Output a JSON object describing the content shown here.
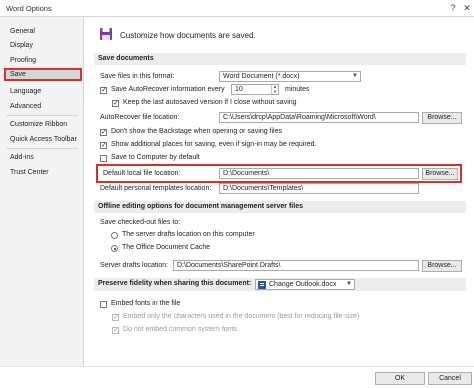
{
  "window": {
    "title": "Word Options",
    "help_icon": "?",
    "close_icon": "✕"
  },
  "nav": {
    "items": [
      {
        "label": "General"
      },
      {
        "label": "Display"
      },
      {
        "label": "Proofing"
      },
      {
        "label": "Save"
      },
      {
        "label": "Language"
      },
      {
        "label": "Advanced"
      },
      {
        "label": "Customize Ribbon"
      },
      {
        "label": "Quick Access Toolbar"
      },
      {
        "label": "Add-ins"
      },
      {
        "label": "Trust Center"
      }
    ],
    "selected": "Save"
  },
  "header": {
    "text": "Customize how documents are saved.",
    "icon": "save-icon"
  },
  "save_documents": {
    "title": "Save documents",
    "format_label": "Save files in this format:",
    "format_value": "Word Document (*.docx)",
    "autorecover_label": "Save AutoRecover information every",
    "autorecover_checked": true,
    "autorecover_minutes": "10",
    "minutes_label": "minutes",
    "keep_last_label": "Keep the last autosaved version if I close without saving",
    "keep_last_checked": true,
    "autorecover_location_label": "AutoRecover file location:",
    "autorecover_location_value": "C:\\Users\\drcp\\AppData\\Roaming\\Microsoft\\Word\\",
    "browse_label": "Browse...",
    "backstage_label": "Don't show the Backstage when opening or saving files",
    "backstage_checked": true,
    "additional_places_label": "Show additional places for saving, even if sign-in may be required.",
    "additional_places_checked": true,
    "save_computer_label": "Save to Computer by default",
    "save_computer_checked": false,
    "default_local_label": "Default local file location:",
    "default_local_value": "D:\\Documents\\",
    "default_templates_label": "Default personal templates location:",
    "default_templates_value": "D:\\Documents\\Templates\\"
  },
  "offline": {
    "title": "Offline editing options for document management server files",
    "checked_out_label": "Save checked-out files to:",
    "radio_server_label": "The server drafts location on this computer",
    "radio_server_selected": false,
    "radio_cache_label": "The Office Document Cache",
    "radio_cache_selected": true,
    "server_drafts_label": "Server drafts location:",
    "server_drafts_value": "D:\\Documents\\SharePoint Drafts\\",
    "browse_label": "Browse..."
  },
  "fidelity": {
    "title": "Preserve fidelity when sharing this document:",
    "document_value": "Change Outlook.docx",
    "embed_fonts_label": "Embed fonts in the file",
    "embed_fonts_checked": false,
    "embed_only_label": "Embed only the characters used in the document (best for reducing file size)",
    "embed_only_checked": true,
    "no_common_label": "Do not embed common system fonts",
    "no_common_checked": true
  },
  "footer": {
    "ok_label": "OK",
    "cancel_label": "Cancel"
  },
  "colors": {
    "highlight": "#d9302c",
    "icon_purple": "#7a3f8f"
  }
}
